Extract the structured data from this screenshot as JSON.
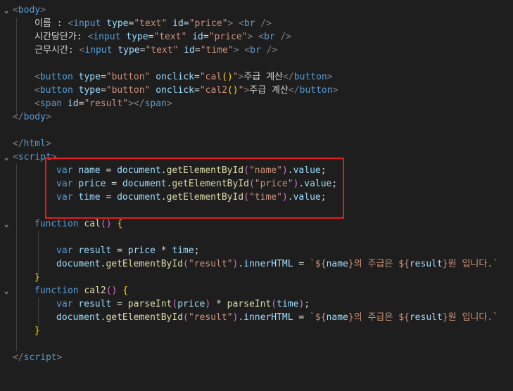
{
  "code": {
    "l1": {
      "body_open": "body"
    },
    "l2": {
      "label": "이름 : ",
      "tag": "input",
      "attr1": "type",
      "val1": "\"text\"",
      "attr2": "id",
      "val2": "\"price\"",
      "br": "br"
    },
    "l3": {
      "label": "시간당단가: ",
      "tag": "input",
      "attr1": "type",
      "val1": "\"text\"",
      "attr2": "id",
      "val2": "\"price\"",
      "br": "br"
    },
    "l4": {
      "label": "근무시간: ",
      "tag": "input",
      "attr1": "type",
      "val1": "\"text\"",
      "attr2": "id",
      "val2": "\"time\"",
      "br": "br"
    },
    "l6": {
      "tag": "button",
      "attr1": "type",
      "val1": "\"button\"",
      "attr2": "onclick",
      "val2a": "\"cal",
      "val2b": "()",
      "val2c": "\"",
      "text": "주급 계산",
      "close": "button"
    },
    "l7": {
      "tag": "button",
      "attr1": "type",
      "val1": "\"button\"",
      "attr2": "onclick",
      "val2a": "\"cal2",
      "val2b": "()",
      "val2c": "\"",
      "text": "주급 계산",
      "close": "button"
    },
    "l8": {
      "tag": "span",
      "attr": "id",
      "val": "\"result\"",
      "close": "span"
    },
    "l9": {
      "body_close": "body"
    },
    "l11": {
      "html_close": "html"
    },
    "l12": {
      "script_open": "script"
    },
    "l13": {
      "kw": "var",
      "name": "name",
      "eq": " = ",
      "obj": "document",
      "fn": "getElementById",
      "arg": "\"name\"",
      "prop": "value"
    },
    "l14": {
      "kw": "var",
      "name": "price",
      "eq": " = ",
      "obj": "document",
      "fn": "getElementById",
      "arg": "\"price\"",
      "prop": "value"
    },
    "l15": {
      "kw": "var",
      "name": "time",
      "eq": " = ",
      "obj": "document",
      "fn": "getElementById",
      "arg": "\"time\"",
      "prop": "value"
    },
    "l17": {
      "kw": "function",
      "fn": "cal"
    },
    "l19": {
      "kw": "var",
      "name": "result",
      "a": "price",
      "op": " * ",
      "b": "time"
    },
    "l20": {
      "obj": "document",
      "fn": "getElementById",
      "arg": "\"result\"",
      "prop": "innerHTML",
      "t1": "`${",
      "v1": "name",
      "t2": "}의 주급은 ${",
      "v2": "result",
      "t3": "}원 입니다.`"
    },
    "l22": {
      "kw": "function",
      "fn": "cal2"
    },
    "l23": {
      "kw": "var",
      "name": "result",
      "fn1": "parseInt",
      "a": "price",
      "op": " * ",
      "fn2": "parseInt",
      "b": "time"
    },
    "l24": {
      "obj": "document",
      "fn": "getElementById",
      "arg": "\"result\"",
      "prop": "innerHTML",
      "t1": "`${",
      "v1": "name",
      "t2": "}의 주급은 ${",
      "v2": "result",
      "t3": "}원 입니다.`"
    },
    "l26": {
      "script_close": "script"
    }
  },
  "colors": {
    "highlight": "#e51b1b",
    "background": "#1e1e1e"
  }
}
